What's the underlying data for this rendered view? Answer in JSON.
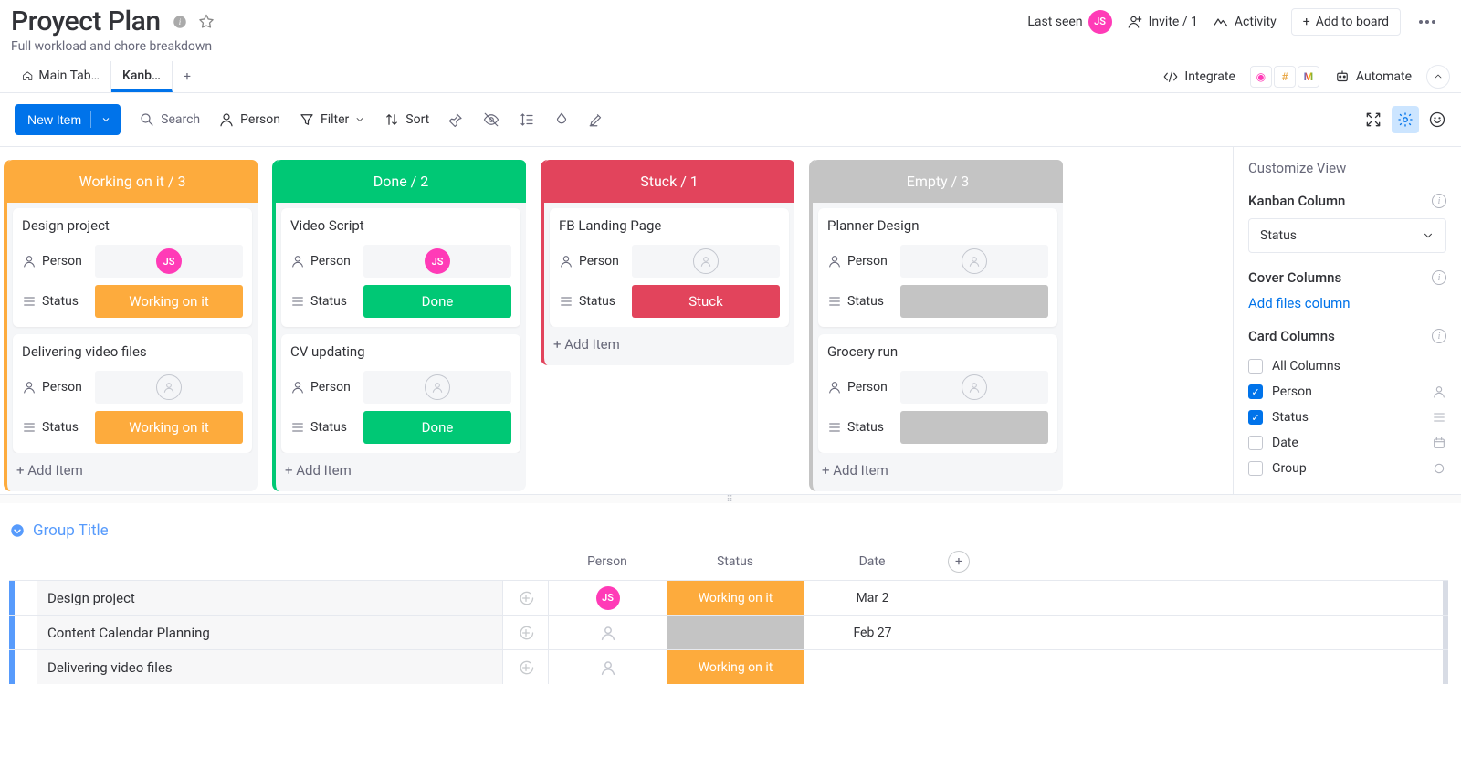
{
  "header": {
    "title": "Proyect Plan",
    "subtitle": "Full workload and chore breakdown",
    "last_seen": "Last seen",
    "avatar_initials": "JS",
    "invite": "Invite / 1",
    "activity": "Activity",
    "add_to_board": "Add to board"
  },
  "tabs": {
    "main": "Main Tab…",
    "kanban": "Kanb…",
    "integrate": "Integrate",
    "automate": "Automate"
  },
  "toolbar": {
    "new_item": "New Item",
    "search": "Search",
    "person": "Person",
    "filter": "Filter",
    "sort": "Sort"
  },
  "kanban": {
    "add_item": "+ Add Item",
    "labels": {
      "person": "Person",
      "status": "Status"
    },
    "columns": [
      {
        "key": "working",
        "header": "Working on it / 3",
        "cards": [
          {
            "title": "Design project",
            "person": "JS",
            "status": {
              "label": "Working on it",
              "cls": "status-working"
            }
          },
          {
            "title": "Delivering video files",
            "person": null,
            "status": {
              "label": "Working on it",
              "cls": "status-working"
            }
          }
        ]
      },
      {
        "key": "done",
        "header": "Done / 2",
        "cards": [
          {
            "title": "Video Script",
            "person": "JS",
            "status": {
              "label": "Done",
              "cls": "status-done"
            }
          },
          {
            "title": "CV updating",
            "person": null,
            "status": {
              "label": "Done",
              "cls": "status-done"
            }
          }
        ]
      },
      {
        "key": "stuck",
        "header": "Stuck / 1",
        "cards": [
          {
            "title": "FB Landing Page",
            "person": null,
            "status": {
              "label": "Stuck",
              "cls": "status-stuck"
            }
          }
        ]
      },
      {
        "key": "empty",
        "header": "Empty / 3",
        "cards": [
          {
            "title": "Planner Design",
            "person": null,
            "status": {
              "label": "",
              "cls": "status-empty"
            }
          },
          {
            "title": "Grocery run",
            "person": null,
            "status": {
              "label": "",
              "cls": "status-empty"
            }
          }
        ]
      }
    ]
  },
  "panel": {
    "title": "Customize View",
    "kanban_col": "Kanban Column",
    "kanban_sel": "Status",
    "cover_cols": "Cover Columns",
    "add_files": "Add files column",
    "card_cols": "Card Columns",
    "options": {
      "all": "All Columns",
      "person": "Person",
      "status": "Status",
      "date": "Date",
      "group": "Group"
    }
  },
  "grid": {
    "group_title": "Group Title",
    "cols": {
      "person": "Person",
      "status": "Status",
      "date": "Date"
    },
    "rows": [
      {
        "name": "Design project",
        "person": "JS",
        "status": {
          "label": "Working on it",
          "cls": "working"
        },
        "date": "Mar 2"
      },
      {
        "name": "Content Calendar Planning",
        "person": null,
        "status": {
          "label": "",
          "cls": "grey"
        },
        "date": "Feb 27"
      },
      {
        "name": "Delivering video files",
        "person": null,
        "status": {
          "label": "Working on it",
          "cls": "working"
        },
        "date": ""
      }
    ]
  }
}
